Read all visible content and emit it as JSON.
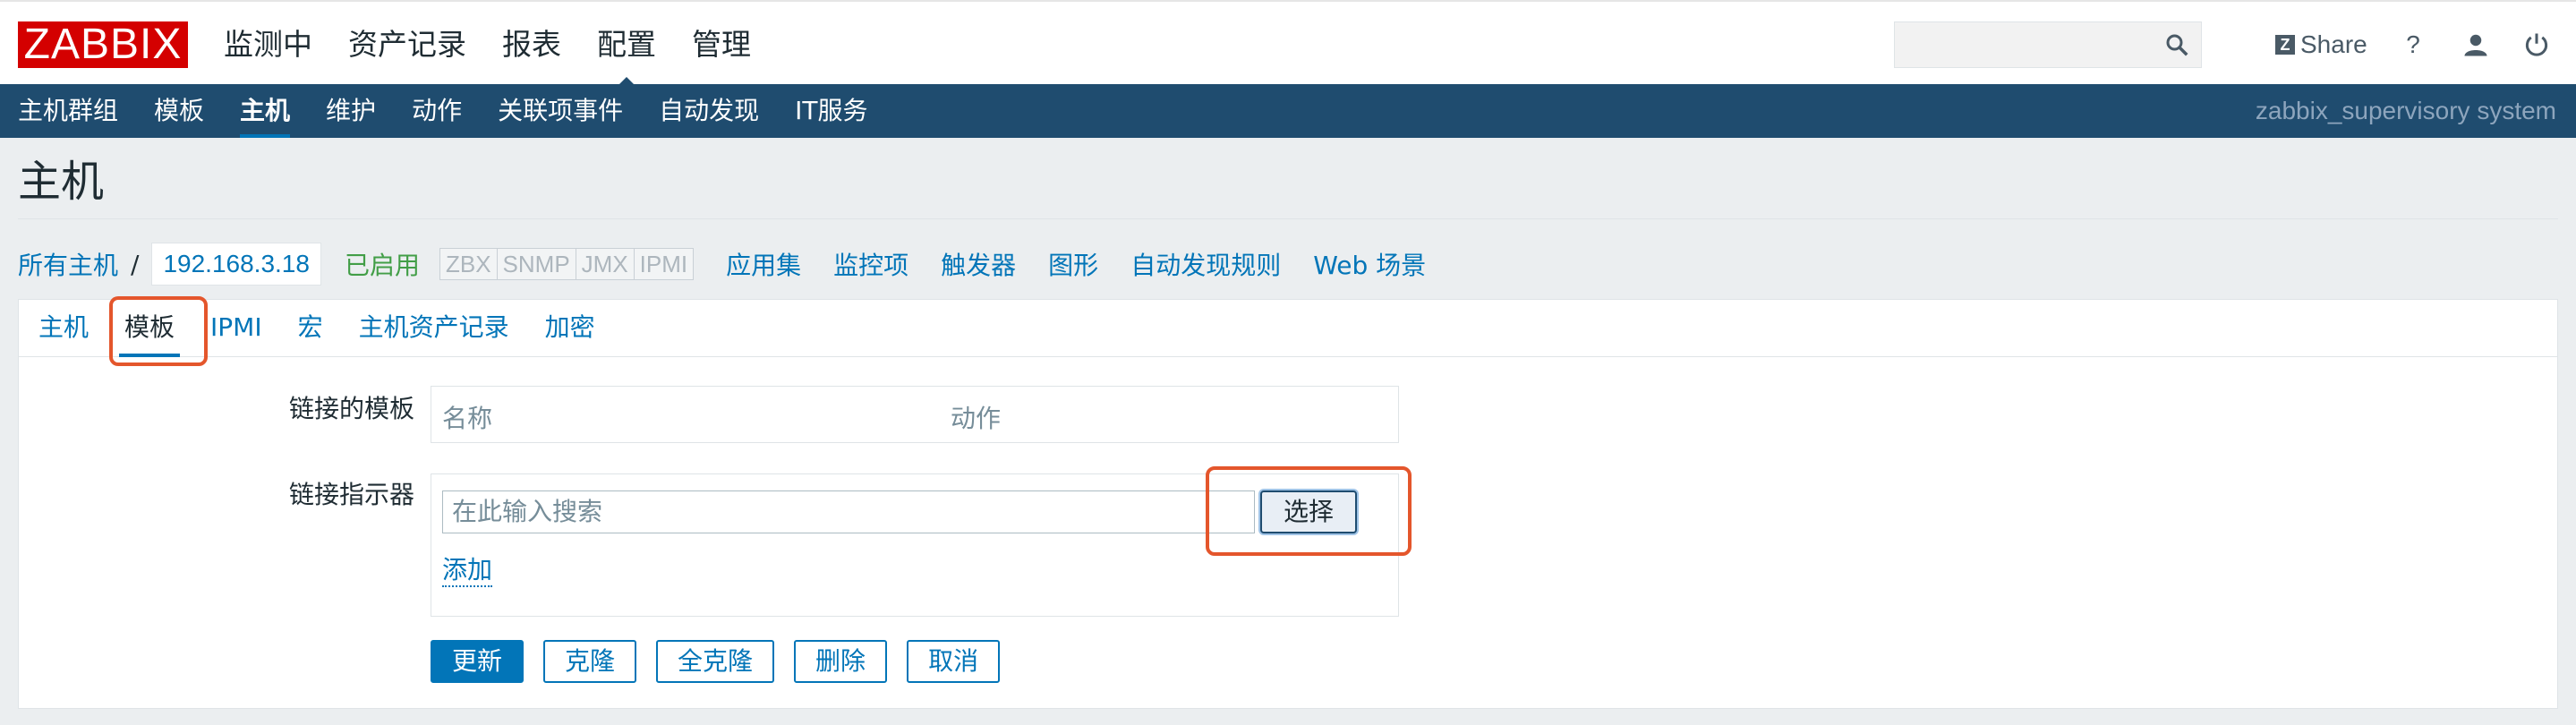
{
  "header": {
    "logo": "ZABBIX",
    "main_nav": [
      "监测中",
      "资产记录",
      "报表",
      "配置",
      "管理"
    ],
    "active_main": "配置",
    "search": {
      "placeholder": "",
      "value": ""
    },
    "share_label": "Share",
    "help_label": "?",
    "icons": [
      "search-icon",
      "share-icon",
      "help-icon",
      "user-icon",
      "power-icon"
    ]
  },
  "subnav": {
    "items": [
      "主机群组",
      "模板",
      "主机",
      "维护",
      "动作",
      "关联项事件",
      "自动发现",
      "IT服务"
    ],
    "active": "主机",
    "system_name": "zabbix_supervisory system"
  },
  "page": {
    "title": "主机"
  },
  "breadcrumb": {
    "all_hosts": "所有主机",
    "separator": "/",
    "host": "192.168.3.18",
    "status": "已启用",
    "badges": [
      "ZBX",
      "SNMP",
      "JMX",
      "IPMI"
    ],
    "links": [
      "应用集",
      "监控项",
      "触发器",
      "图形",
      "自动发现规则",
      "Web 场景"
    ]
  },
  "tabs": [
    "主机",
    "模板",
    "IPMI",
    "宏",
    "主机资产记录",
    "加密"
  ],
  "active_tab": "模板",
  "form": {
    "linked_templates_label": "链接的模板",
    "table_headers": [
      "名称",
      "动作"
    ],
    "link_indicator_label": "链接指示器",
    "search_placeholder": "在此输入搜索",
    "select_button": "选择",
    "add_link": "添加",
    "buttons": [
      "更新",
      "克隆",
      "全克隆",
      "删除",
      "取消"
    ]
  },
  "colors": {
    "header_bg": "#ffffff",
    "subnav_bg": "#1f4c6f",
    "link": "#0275b8",
    "enabled": "#429e47",
    "highlight": "#e4562c",
    "logo_red": "#d40000"
  }
}
